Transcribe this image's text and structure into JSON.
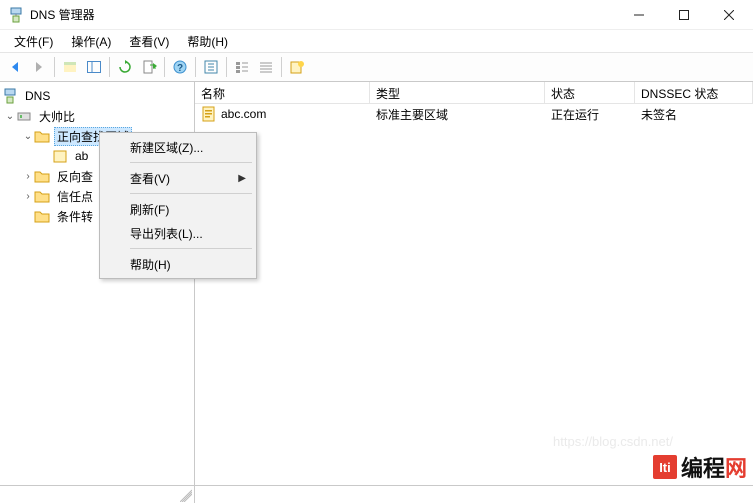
{
  "window": {
    "title": "DNS 管理器"
  },
  "menubar": {
    "file": "文件(F)",
    "action": "操作(A)",
    "view": "查看(V)",
    "help": "帮助(H)"
  },
  "tree": {
    "root": "DNS",
    "server": "大帅比",
    "forward": "正向查找区域",
    "forward_child": "ab",
    "reverse": "反向查",
    "trust": "信任点",
    "conditional": "条件转"
  },
  "columns": {
    "name": "名称",
    "type": "类型",
    "status": "状态",
    "dnssec": "DNSSEC 状态"
  },
  "rows": [
    {
      "name": "abc.com",
      "type": "标准主要区域",
      "status": "正在运行",
      "dnssec": "未签名"
    }
  ],
  "context_menu": {
    "new_zone": "新建区域(Z)...",
    "view": "查看(V)",
    "refresh": "刷新(F)",
    "export_list": "导出列表(L)...",
    "help": "帮助(H)"
  },
  "watermark": {
    "logo": "Iti",
    "text_black": "编程",
    "text_red": "网"
  },
  "faint_url": "https://blog.csdn.net/"
}
